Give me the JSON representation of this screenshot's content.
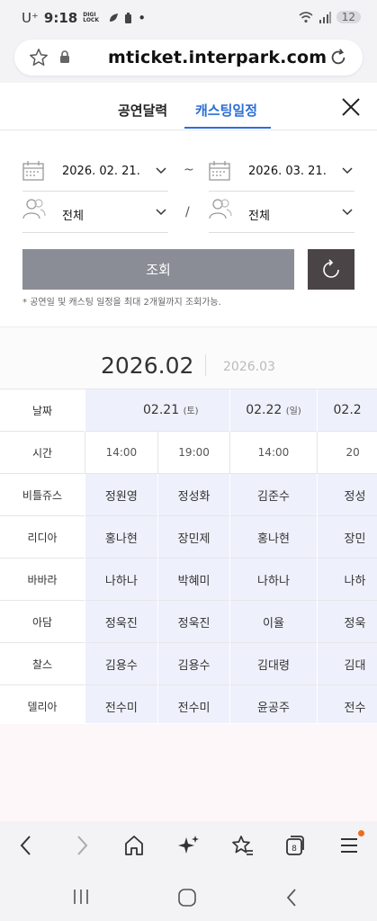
{
  "status": {
    "carrier": "U⁺",
    "time": "9:18",
    "lock_label": "DIGI LOCK",
    "notif_count": "12"
  },
  "browser": {
    "url": "mticket.interpark.com"
  },
  "tabs": [
    {
      "label": "공연달력",
      "active": false
    },
    {
      "label": "캐스팅일정",
      "active": true
    }
  ],
  "filters": {
    "start_date": "2026. 02. 21.",
    "end_date": "2026. 03. 21.",
    "date_sep": "~",
    "left_actor": "전체",
    "right_actor": "전체",
    "actor_sep": "/"
  },
  "search_button": "조회",
  "note": "공연일 및 캐스팅 일정을 최대 2개월까지 조회가능.",
  "months": {
    "current": "2026.02",
    "next": "2026.03"
  },
  "schedule": {
    "date_label": "날짜",
    "time_label": "시간",
    "dates": [
      {
        "date": "02.21",
        "dow": "(토)"
      },
      {
        "date": "",
        "dow": ""
      },
      {
        "date": "02.22",
        "dow": "(일)"
      },
      {
        "date": "02.2",
        "dow": ""
      }
    ],
    "times": [
      "14:00",
      "19:00",
      "14:00",
      "20"
    ],
    "rows": [
      {
        "role": "비틀쥬스",
        "casts": [
          "정원영",
          "정성화",
          "김준수",
          "정성"
        ]
      },
      {
        "role": "리디아",
        "casts": [
          "홍나현",
          "장민제",
          "홍나현",
          "장민"
        ]
      },
      {
        "role": "바바라",
        "casts": [
          "나하나",
          "박혜미",
          "나하나",
          "나하"
        ]
      },
      {
        "role": "아담",
        "casts": [
          "정욱진",
          "정욱진",
          "이율",
          "정욱"
        ]
      },
      {
        "role": "찰스",
        "casts": [
          "김용수",
          "김용수",
          "김대령",
          "김대"
        ]
      },
      {
        "role": "델리아",
        "casts": [
          "전수미",
          "전수미",
          "윤공주",
          "전수"
        ]
      }
    ]
  },
  "colors": {
    "accent": "#2a6fd6",
    "search_button": "#8a8d95",
    "reset_button": "#4a4447",
    "cell_bg": "#eef1fb"
  }
}
